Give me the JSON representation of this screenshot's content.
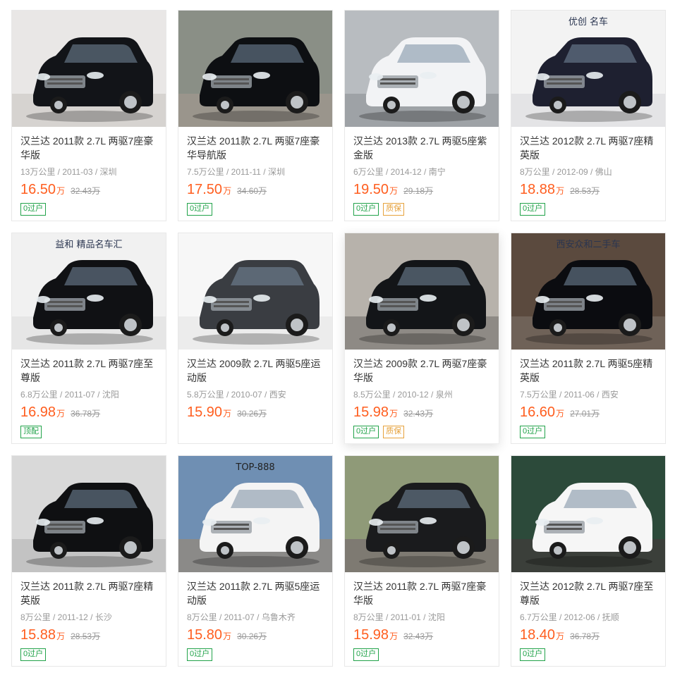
{
  "listings": [
    {
      "title": "汉兰达 2011款 2.7L 两驱7座豪华版",
      "meta": "13万公里 / 2011-03 / 深圳",
      "price": "16.50",
      "unit": "万",
      "original_price": "32.43万",
      "tags": [
        "0过户"
      ],
      "photo": {
        "bg": "#e9e7e6",
        "car": "#121418",
        "ground": "#d6d3d0",
        "label": "",
        "icon": "car-photo"
      }
    },
    {
      "title": "汉兰达 2011款 2.7L 两驱7座豪华导航版",
      "meta": "7.5万公里 / 2011-11 / 深圳",
      "price": "17.50",
      "unit": "万",
      "original_price": "34.60万",
      "tags": [
        "0过户"
      ],
      "photo": {
        "bg": "#8a8f86",
        "car": "#0d0f12",
        "ground": "#9a958c",
        "label": "",
        "icon": "car-photo"
      }
    },
    {
      "title": "汉兰达 2013款 2.7L 两驱5座紫金版",
      "meta": "6万公里 / 2014-12 / 南宁",
      "price": "19.50",
      "unit": "万",
      "original_price": "29.18万",
      "tags": [
        "0过户",
        "质保"
      ],
      "photo": {
        "bg": "#b8bcc0",
        "car": "#f2f3f5",
        "ground": "#9ea2a6",
        "label": "",
        "icon": "car-photo"
      }
    },
    {
      "title": "汉兰达 2012款 2.7L 两驱7座精英版",
      "meta": "8万公里 / 2012-09 / 佛山",
      "price": "18.88",
      "unit": "万",
      "original_price": "28.53万",
      "tags": [
        "0过户"
      ],
      "photo": {
        "bg": "#f3f3f3",
        "car": "#1e2030",
        "ground": "#e4e4e6",
        "label": "优创 名车",
        "icon": "car-photo"
      }
    },
    {
      "title": "汉兰达 2011款 2.7L 两驱7座至尊版",
      "meta": "6.8万公里 / 2011-07 / 沈阳",
      "price": "16.98",
      "unit": "万",
      "original_price": "36.78万",
      "tags": [
        "顶配"
      ],
      "photo": {
        "bg": "#f1f1f1",
        "car": "#101114",
        "ground": "#e6e6e6",
        "label": "益和 精品名车汇",
        "icon": "car-photo"
      }
    },
    {
      "title": "汉兰达 2009款 2.7L 两驱5座运动版",
      "meta": "5.8万公里 / 2010-07 / 西安",
      "price": "15.90",
      "unit": "万",
      "original_price": "30.26万",
      "tags": [],
      "photo": {
        "bg": "#f7f7f7",
        "car": "#3a3d42",
        "ground": "#ececec",
        "label": "",
        "icon": "car-photo"
      }
    },
    {
      "title": "汉兰达 2009款 2.7L 两驱7座豪华版",
      "meta": "8.5万公里 / 2010-12 / 泉州",
      "price": "15.98",
      "unit": "万",
      "original_price": "32.43万",
      "tags": [
        "0过户",
        "质保"
      ],
      "photo": {
        "bg": "#b7b2ab",
        "car": "#131518",
        "ground": "#8e8a85",
        "label": "",
        "icon": "car-photo"
      }
    },
    {
      "title": "汉兰达 2011款 2.7L 两驱5座精英版",
      "meta": "7.5万公里 / 2011-06 / 西安",
      "price": "16.60",
      "unit": "万",
      "original_price": "27.01万",
      "tags": [
        "0过户"
      ],
      "photo": {
        "bg": "#5b4a3e",
        "car": "#0b0c10",
        "ground": "#6f6258",
        "label": "西安众和二手车",
        "icon": "car-photo"
      }
    },
    {
      "title": "汉兰达 2011款 2.7L 两驱7座精英版",
      "meta": "8万公里 / 2011-12 / 长沙",
      "price": "15.88",
      "unit": "万",
      "original_price": "28.53万",
      "tags": [
        "0过户"
      ],
      "photo": {
        "bg": "#d9d9d9",
        "car": "#0f1012",
        "ground": "#c3c3c3",
        "label": "",
        "icon": "car-photo"
      }
    },
    {
      "title": "汉兰达 2011款 2.7L 两驱5座运动版",
      "meta": "8万公里 / 2011-07 / 乌鲁木齐",
      "price": "15.80",
      "unit": "万",
      "original_price": "30.26万",
      "tags": [
        "0过户"
      ],
      "photo": {
        "bg": "#6f8fb3",
        "car": "#f4f4f4",
        "ground": "#8b8a88",
        "label": "TOP-888",
        "icon": "car-photo"
      }
    },
    {
      "title": "汉兰达 2011款 2.7L 两驱7座豪华版",
      "meta": "8万公里 / 2011-01 / 沈阳",
      "price": "15.98",
      "unit": "万",
      "original_price": "32.43万",
      "tags": [
        "0过户"
      ],
      "photo": {
        "bg": "#8f9a78",
        "car": "#1a1b1d",
        "ground": "#7e7a72",
        "label": "",
        "icon": "car-photo"
      }
    },
    {
      "title": "汉兰达 2012款 2.7L 两驱7座至尊版",
      "meta": "6.7万公里 / 2012-06 / 抚顺",
      "price": "18.40",
      "unit": "万",
      "original_price": "36.78万",
      "tags": [
        "0过户"
      ],
      "photo": {
        "bg": "#2c4a3a",
        "car": "#f6f6f6",
        "ground": "#3b3f3a",
        "label": "",
        "icon": "car-photo"
      }
    }
  ],
  "hovered_index": 6,
  "colors": {
    "price": "#ff5e1f",
    "tag_green": "#22a34a",
    "tag_orange": "#e6a23c"
  }
}
